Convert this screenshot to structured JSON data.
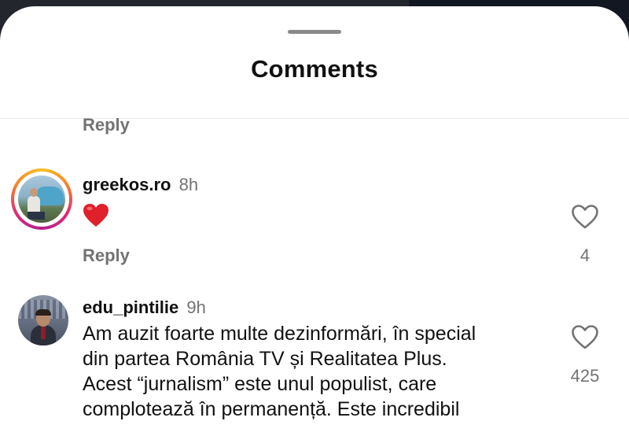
{
  "sheet": {
    "title": "Comments"
  },
  "previous_reply": {
    "label": "Reply"
  },
  "comments": [
    {
      "username": "greekos.ro",
      "time": "8h",
      "text": "❤️",
      "reply_label": "Reply",
      "likes": "4",
      "avatar_story_ring": true
    },
    {
      "username": "edu_pintilie",
      "time": "9h",
      "text": "Am auzit foarte multe dezinformări, în special\ndin partea România TV și Realitatea Plus.\nAcest “jurnalism” este unul populist, care\ncomplotează în permanență. Este incredibil",
      "likes": "425",
      "avatar_story_ring": false
    }
  ],
  "colors": {
    "secondary_text": "#737373",
    "heart_red": "#e0202a",
    "story_ring": [
      "#f9c02b",
      "#f58529",
      "#dd2a7b",
      "#b1228e"
    ]
  },
  "icons": {
    "like": "heart-outline-icon",
    "drag": "drag-handle-icon"
  }
}
